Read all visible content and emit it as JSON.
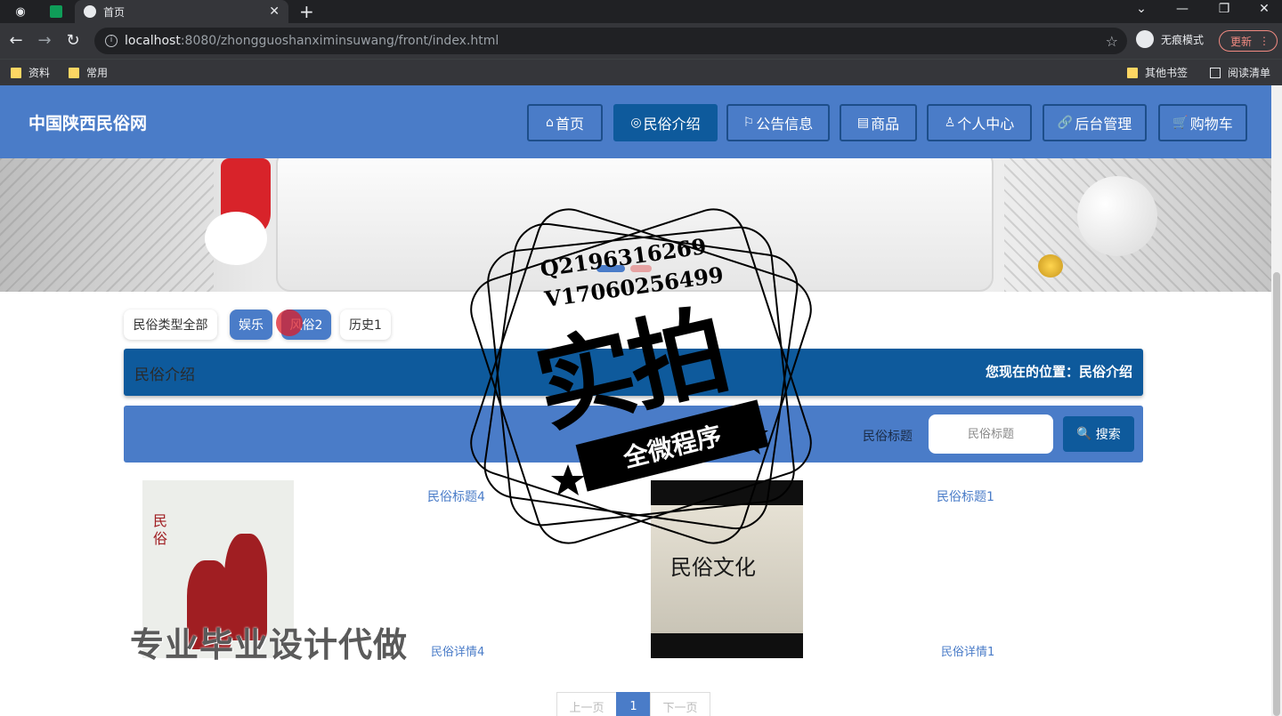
{
  "browser": {
    "tab_title": "首页",
    "url_host": "localhost",
    "url_rest": ":8080/zhongguoshanximinsuwang/front/index.html",
    "incognito_label": "无痕模式",
    "update_label": "更新",
    "bookmarks": [
      "资料",
      "常用"
    ],
    "other_bookmarks": "其他书签",
    "reading_list": "阅读清单"
  },
  "site": {
    "title": "中国陕西民俗网",
    "nav": [
      {
        "icon": "⌂",
        "label": "首页"
      },
      {
        "icon": "◎",
        "label": "民俗介绍"
      },
      {
        "icon": "⚐",
        "label": "公告信息"
      },
      {
        "icon": "▤",
        "label": "商品"
      },
      {
        "icon": "♙",
        "label": "个人中心"
      },
      {
        "icon": "🔗",
        "label": "后台管理"
      },
      {
        "icon": "🛒",
        "label": "购物车"
      }
    ]
  },
  "filters": [
    "民俗类型全部",
    "娱乐",
    "风俗2",
    "历史1"
  ],
  "section": {
    "title": "民俗介绍",
    "location": "您现在的位置：民俗介绍"
  },
  "search": {
    "label": "民俗标题",
    "placeholder": "民俗标题",
    "button": "搜索"
  },
  "cards": [
    {
      "title": "民俗标题4",
      "detail": "民俗详情4",
      "image_text": "民\n俗"
    },
    {
      "title": "民俗标题1",
      "detail": "民俗详情1",
      "image_text": "民俗文化"
    }
  ],
  "pagination": {
    "prev": "上一页",
    "current": "1",
    "next": "下一页"
  },
  "watermark": {
    "qq": "Q2196316269",
    "wechat": "V17060256499",
    "big": "实拍",
    "ribbon": "全微程序",
    "bottom": "专业毕业设计代做"
  },
  "colors": {
    "header_blue": "#4a7cc8",
    "dark_blue": "#0e5a9c",
    "browser_dark": "#202124"
  }
}
